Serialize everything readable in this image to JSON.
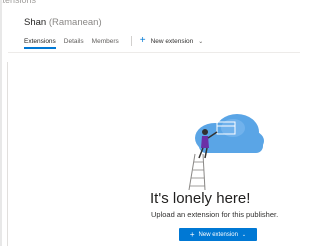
{
  "breadcrumb": {
    "label": "xtensions"
  },
  "publisher": {
    "name": "Shan",
    "subtitle": "(Ramanean)"
  },
  "tabs": [
    {
      "label": "Extensions",
      "active": true
    },
    {
      "label": "Details",
      "active": false
    },
    {
      "label": "Members",
      "active": false
    }
  ],
  "toolbar": {
    "new_extension_label": "New extension"
  },
  "empty_state": {
    "title": "It's lonely here!",
    "subtitle": "Upload an extension for this publisher.",
    "button_label": "New extension"
  },
  "colors": {
    "accent": "#0078d4",
    "cloud": "#5aa5e6",
    "cloud_light": "#7ab8ee"
  },
  "icons": [
    "plus-icon",
    "chevron-down-icon",
    "cloud-ladder-illustration"
  ]
}
